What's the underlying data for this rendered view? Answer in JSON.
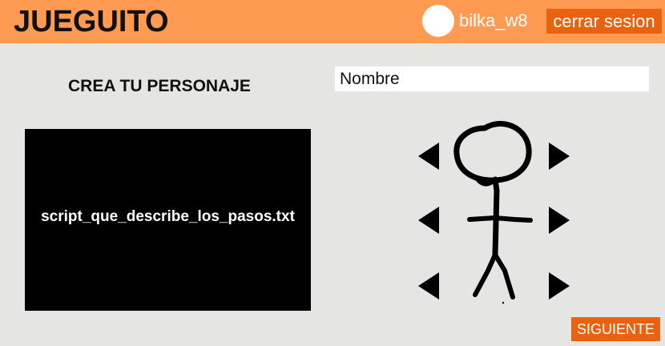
{
  "header": {
    "app_title": "JUEGUITO",
    "username": "bilka_w8",
    "logout_label": "cerrar sesion"
  },
  "main": {
    "section_title": "CREA TU PERSONAJE",
    "name_placeholder": "Nombre",
    "name_value": "",
    "script_label": "script_que_describe_los_pasos.txt",
    "next_label": "SIGUIENTE"
  },
  "character": {
    "rows": [
      "head",
      "body",
      "legs"
    ],
    "icons": [
      "arrow-left-icon",
      "arrow-right-icon",
      "stick-figure-icon"
    ]
  },
  "colors": {
    "header_bg": "#ff9a52",
    "accent": "#e8620f",
    "page_bg": "#e5e5e3",
    "panel_bg": "#000000"
  }
}
